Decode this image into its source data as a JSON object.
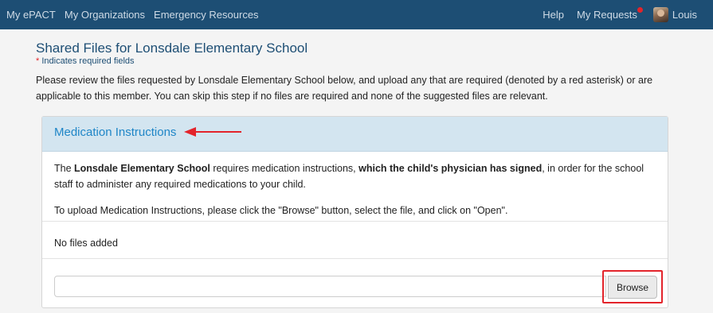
{
  "nav": {
    "left": [
      "My ePACT",
      "My Organizations",
      "Emergency Resources"
    ],
    "help": "Help",
    "requests": "My Requests",
    "user": "Louis"
  },
  "page": {
    "title": "Shared Files for Lonsdale Elementary School",
    "required_star": "*",
    "required_note": "Indicates required fields",
    "intro": "Please review the files requested by Lonsdale Elementary School below, and upload any that are required (denoted by a red asterisk) or are applicable to this member. You can skip this step if no files are required and none of the suggested files are relevant."
  },
  "card": {
    "title": "Medication Instructions",
    "body_p1": {
      "t1": "The ",
      "b1": "Lonsdale Elementary School",
      "t2": " requires medication instructions, ",
      "b2": "which the child's physician has signed",
      "t3": ", in order for the school staff to administer any required medications to your child."
    },
    "body_p2": "To upload Medication Instructions, please click the \"Browse\" button, select the file, and click on \"Open\".",
    "no_files": "No files added",
    "file_value": "",
    "browse_label": "Browse"
  },
  "colors": {
    "navbar": "#1d4e74",
    "header_bg": "#d3e5f0",
    "title_blue": "#1f86c7",
    "annotation_red": "#e3242b"
  }
}
